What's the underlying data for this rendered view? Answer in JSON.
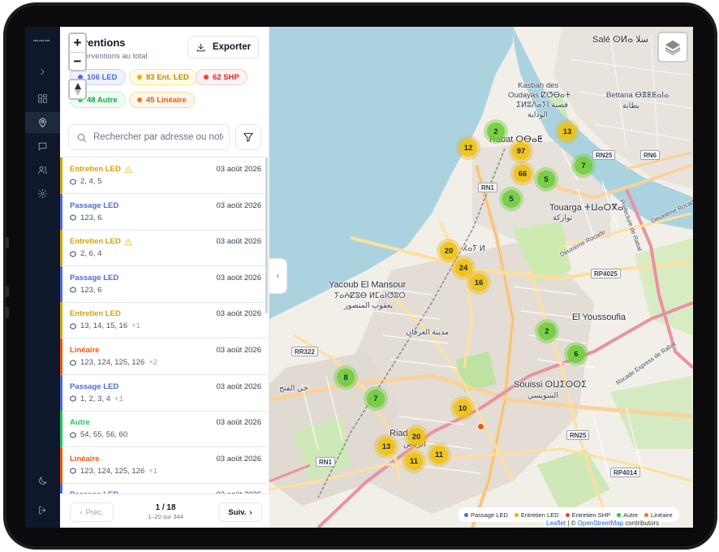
{
  "panel": {
    "title": "rventions",
    "subtitle": "nterventions au total",
    "export_label": "Exporter",
    "chips": [
      {
        "label": "106 LED",
        "color": "#4f6bd8"
      },
      {
        "label": "83 Ent. LED",
        "color": "#eab308"
      },
      {
        "label": "62 SHP",
        "color": "#ef4444"
      },
      {
        "label": "48 Autre",
        "color": "#22c55e"
      },
      {
        "label": "45 Linéaire",
        "color": "#f97316"
      }
    ],
    "search_placeholder": "Rechercher par adresse ou note",
    "items": [
      {
        "type": "Entretien LED",
        "warn": true,
        "date": "03 août 2026",
        "ids": "2, 4, 5",
        "more": "",
        "color": "#d4a10a"
      },
      {
        "type": "Passage LED",
        "warn": false,
        "date": "03 août 2026",
        "ids": "123, 6",
        "more": "",
        "color": "#4f6bd8"
      },
      {
        "type": "Entretien LED",
        "warn": true,
        "date": "03 août 2026",
        "ids": "2, 6, 4",
        "more": "",
        "color": "#d4a10a"
      },
      {
        "type": "Passage LED",
        "warn": false,
        "date": "03 août 2026",
        "ids": "123, 6",
        "more": "",
        "color": "#4f6bd8"
      },
      {
        "type": "Entretien LED",
        "warn": false,
        "date": "03 août 2026",
        "ids": "13, 14, 15, 16",
        "more": "+1",
        "color": "#d4a10a"
      },
      {
        "type": "Linéaire",
        "warn": false,
        "date": "03 août 2026",
        "ids": "123, 124, 125, 126",
        "more": "+2",
        "color": "#ea580c"
      },
      {
        "type": "Passage LED",
        "warn": false,
        "date": "03 août 2026",
        "ids": "1, 2, 3, 4",
        "more": "+1",
        "color": "#4f6bd8"
      },
      {
        "type": "Autre",
        "warn": false,
        "date": "03 août 2026",
        "ids": "54, 55, 56, 60",
        "more": "",
        "color": "#22c55e"
      },
      {
        "type": "Linéaire",
        "warn": false,
        "date": "03 août 2026",
        "ids": "123, 124, 125, 126",
        "more": "+1",
        "color": "#ea580c"
      },
      {
        "type": "Passage LED",
        "warn": false,
        "date": "03 août 2026",
        "ids": "",
        "more": "",
        "color": "#4f6bd8"
      }
    ],
    "pager": {
      "prev": "Préc.",
      "next": "Suiv.",
      "page": "1 / 18",
      "range": "1–20 sur 344"
    }
  },
  "map": {
    "clusters": [
      {
        "count": "2",
        "color": "green"
      },
      {
        "count": "13",
        "color": "yellow"
      },
      {
        "count": "12",
        "color": "yellow"
      },
      {
        "count": "97",
        "color": "yellow"
      },
      {
        "count": "7",
        "color": "green"
      },
      {
        "count": "66",
        "color": "yellow"
      },
      {
        "count": "5",
        "color": "green"
      },
      {
        "count": "5",
        "color": "green"
      },
      {
        "count": "20",
        "color": "yellow"
      },
      {
        "count": "24",
        "color": "yellow"
      },
      {
        "count": "16",
        "color": "yellow"
      },
      {
        "count": "2",
        "color": "green"
      },
      {
        "count": "6",
        "color": "green"
      },
      {
        "count": "8",
        "color": "green"
      },
      {
        "count": "7",
        "color": "green"
      },
      {
        "count": "10",
        "color": "yellow"
      },
      {
        "count": "20",
        "color": "yellow"
      },
      {
        "count": "13",
        "color": "yellow"
      },
      {
        "count": "11",
        "color": "yellow"
      },
      {
        "count": "11",
        "color": "yellow"
      }
    ],
    "places": {
      "sale": "Salé ⵙⵍⴰ سلا",
      "kasbah1": "Kasbah des",
      "kasbah2": "Oudayas ⵇⵚⴱⴰⵜ",
      "kasbah3": "ⵉⵍⵓⴷⴰⵢⵏ قصبة",
      "kasbah4": "الوداية",
      "rabat": "Rabat ⵔⴱⴰⵟ",
      "bettana1": "Bettana ⴱⴻⵟⵟⴰⵏⴰ",
      "bettana2": "بطانة",
      "touarga1": "Touarga ⵜⵡⴰⵔⴳⴰ",
      "touarga2": "تواركة",
      "hay": "ⵃⴰⵢ ⵍ",
      "yacoub1": "Yacoub El Mansour",
      "yacoub2": "ⵢⴰⵄⵇⵓⴱ ⵍⵎⴰⵏⵚⵓⵔ",
      "yacoub3": "يعقوب المنصور",
      "irfane": "مدينة العرفان",
      "youssoufia": "El Youssoufia",
      "souissi1": "Souissi ⵙⵡⵉⵙⵙⵉ",
      "souissi2": "السويسي",
      "fath": "حي الفتح",
      "riad": "Riad",
      "riad2": "الرياض",
      "dbr1": "Deuxième Rocade",
      "dbr2": "Deuxième Rocade",
      "pref": "Préfecture de Rabat",
      "rocade": "Rocade Express de Rabat"
    },
    "roads": [
      "RN25",
      "RN6",
      "RN1",
      "RP4025",
      "RR322",
      "RN1",
      "RN25",
      "RP4014"
    ],
    "legend": [
      {
        "label": "Passage LED",
        "color": "#4f6bd8"
      },
      {
        "label": "Entretien LED",
        "color": "#eab308"
      },
      {
        "label": "Entretien SHP",
        "color": "#ef4444"
      },
      {
        "label": "Autre",
        "color": "#22c55e"
      },
      {
        "label": "Linéaire",
        "color": "#f97316"
      }
    ],
    "attribution_leaflet": "Leaflet",
    "attribution_sep": " | © ",
    "attribution_osm": "OpenStreetMap",
    "attribution_tail": " contributors"
  }
}
